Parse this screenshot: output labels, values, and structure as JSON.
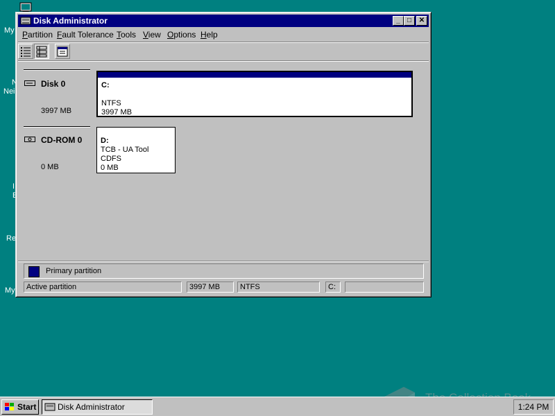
{
  "desktop": {
    "icon_labels": [
      "My",
      "N",
      "Neig",
      "I",
      "E",
      "Re",
      "My"
    ]
  },
  "window": {
    "title": "Disk Administrator",
    "buttons": {
      "minimize": "_",
      "maximize": "□",
      "close": "✕"
    }
  },
  "menu": {
    "items": [
      {
        "pre": "",
        "key": "P",
        "post": "artition"
      },
      {
        "pre": "",
        "key": "F",
        "post": "ault Tolerance"
      },
      {
        "pre": "",
        "key": "T",
        "post": "ools"
      },
      {
        "pre": "",
        "key": "V",
        "post": "iew"
      },
      {
        "pre": "",
        "key": "O",
        "post": "ptions"
      },
      {
        "pre": "",
        "key": "H",
        "post": "elp"
      }
    ]
  },
  "toolbar": {
    "buttons": [
      "volumes-view-icon",
      "disk-configuration-view-icon",
      "properties-icon"
    ]
  },
  "disks": [
    {
      "label": "Disk 0",
      "size": "3997 MB",
      "partition": {
        "drive": "C:",
        "volume_label": "",
        "fs": "NTFS",
        "size": "3997 MB",
        "selected": true
      }
    },
    {
      "label": "CD-ROM 0",
      "size": "0 MB",
      "partition": {
        "drive": "D:",
        "volume_label": "TCB - UA Tool",
        "fs": "CDFS",
        "size": "0 MB",
        "selected": false
      }
    }
  ],
  "legend": {
    "swatch_color": "#000080",
    "label": "Primary partition"
  },
  "status": {
    "field1": "Active partition",
    "field2": "3997 MB",
    "field3": "NTFS",
    "field4": "C:",
    "field5": ""
  },
  "taskbar": {
    "start_label": "Start",
    "task_label": "Disk Administrator",
    "clock": "1:24 PM"
  },
  "watermark": "The Collection Book"
}
